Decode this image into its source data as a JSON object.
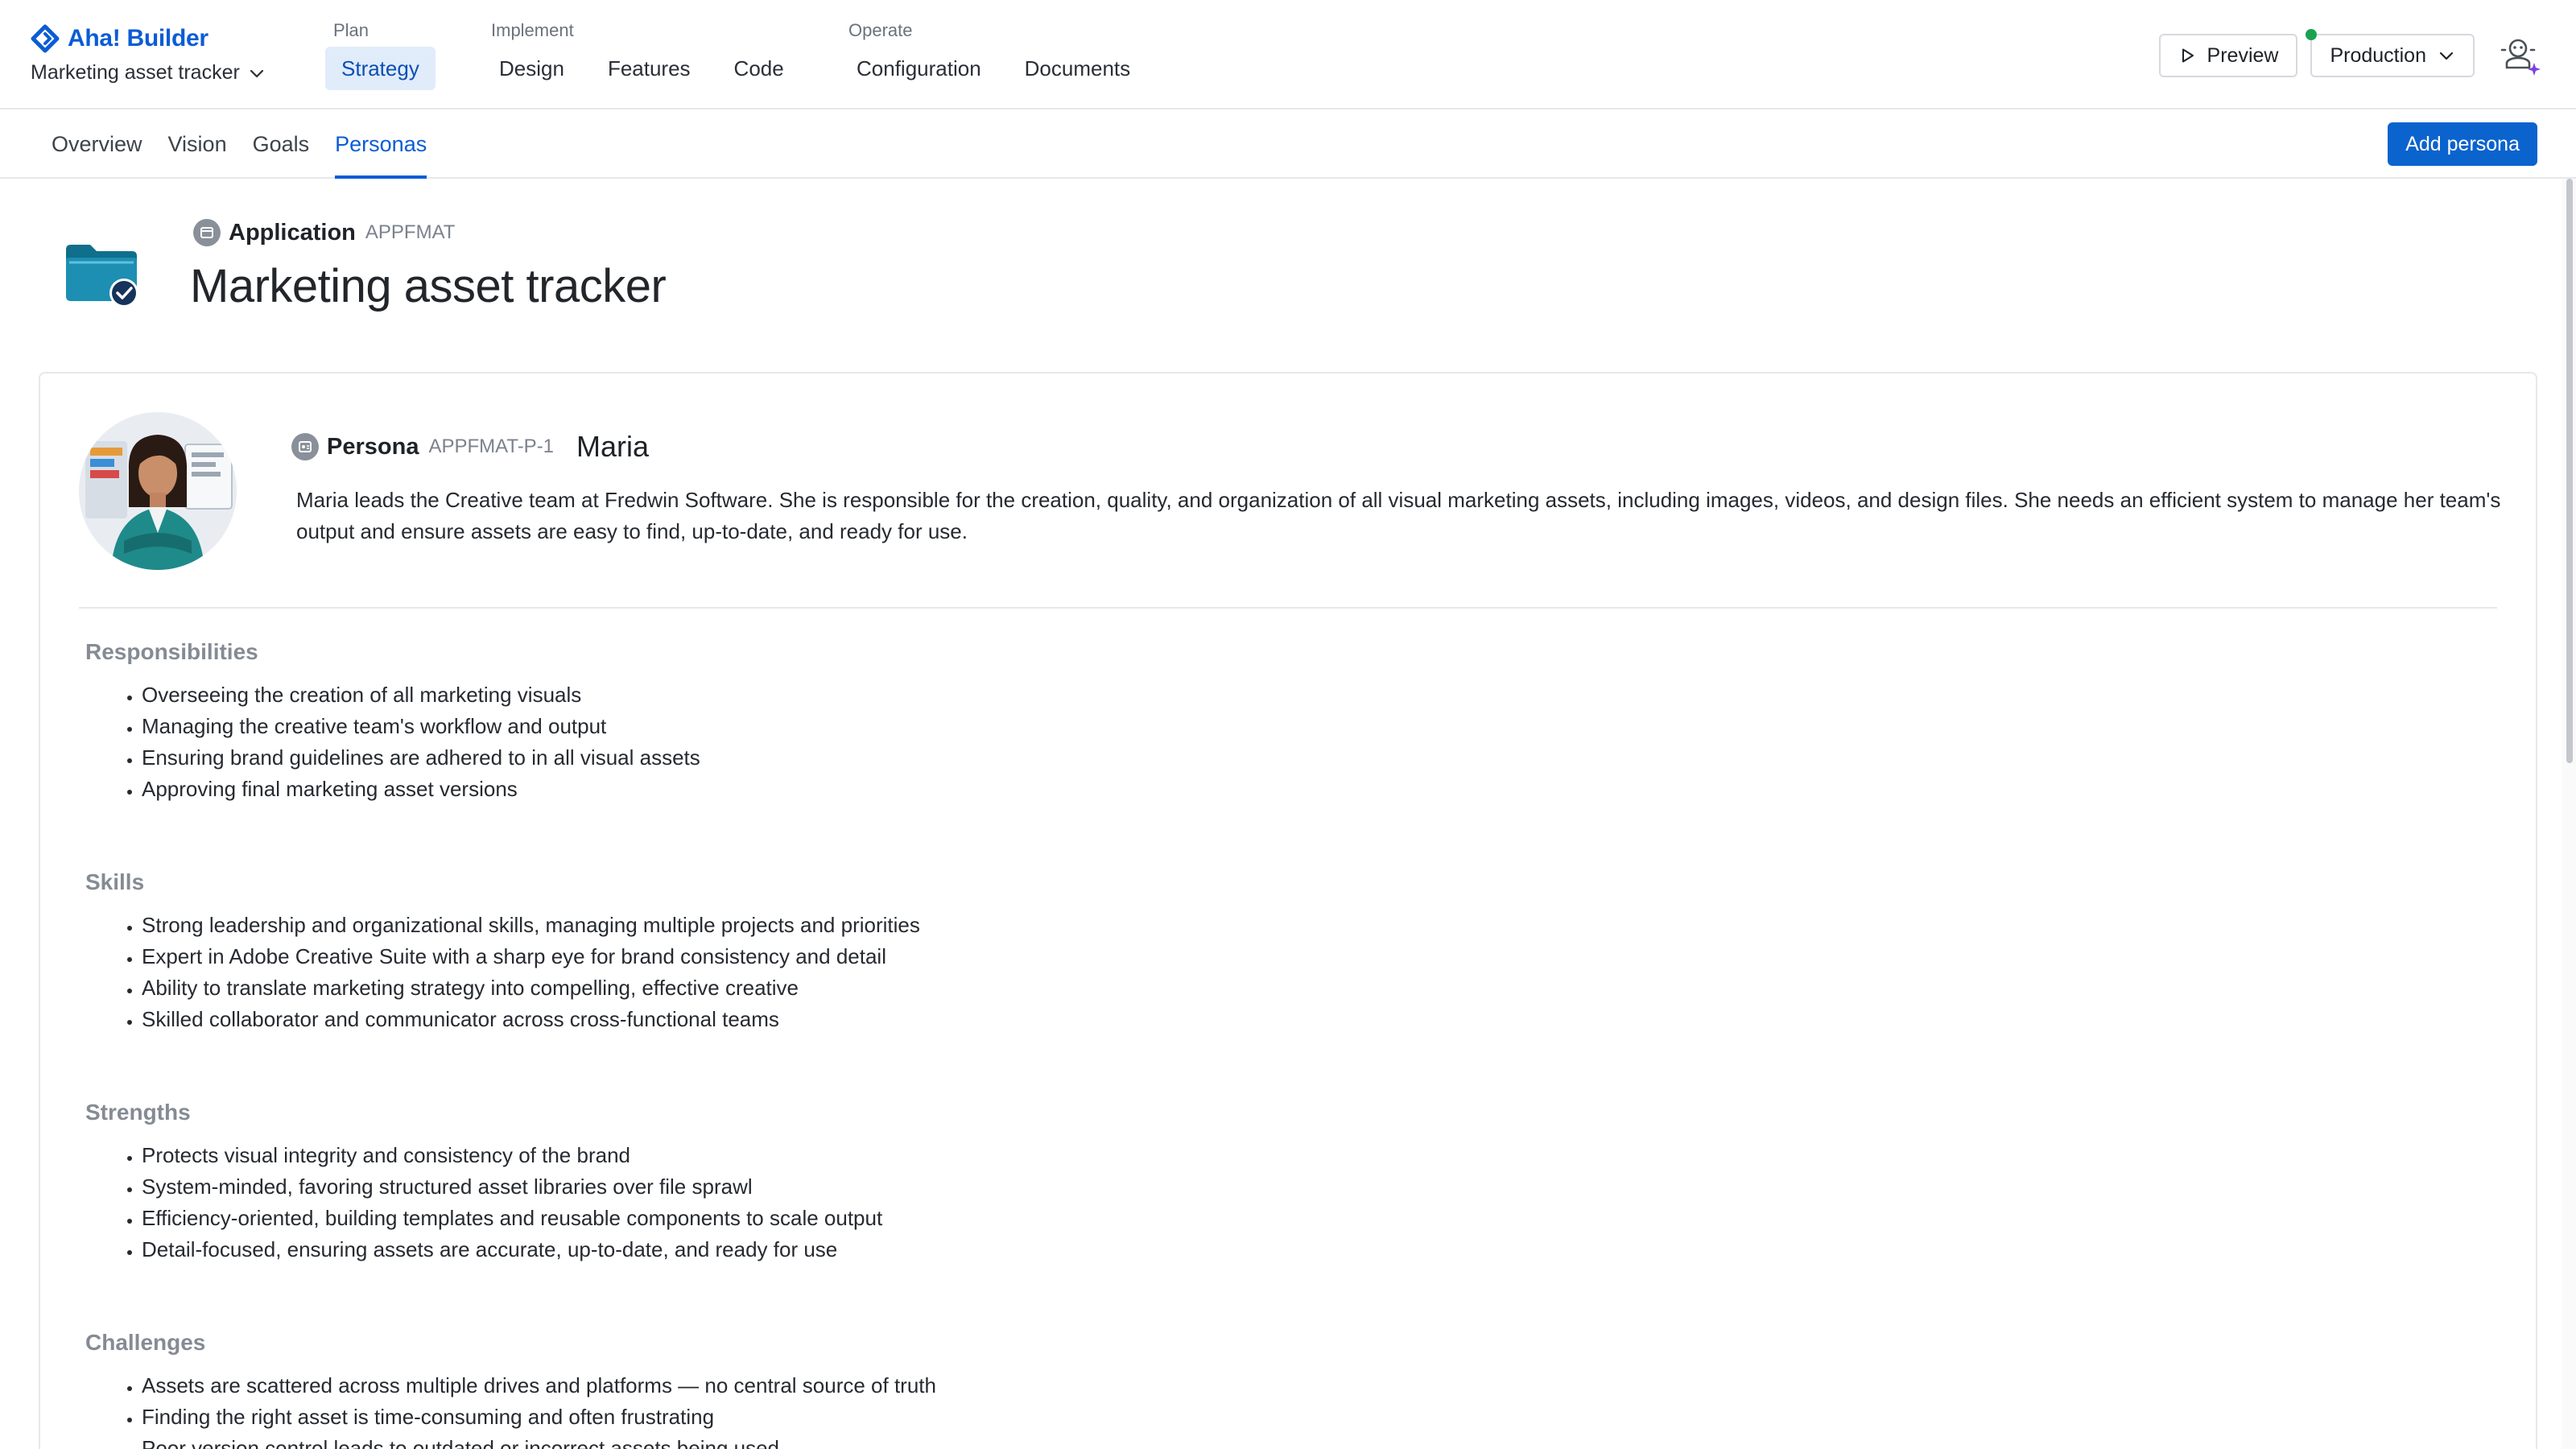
{
  "brand": {
    "name": "Aha! Builder",
    "logo_icon": "aha-diamond-logo-icon"
  },
  "app_switcher": {
    "label": "Marketing asset tracker"
  },
  "nav": {
    "groups": [
      {
        "label": "Plan",
        "items": [
          {
            "label": "Strategy",
            "active": true
          }
        ]
      },
      {
        "label": "Implement",
        "items": [
          {
            "label": "Design"
          },
          {
            "label": "Features"
          },
          {
            "label": "Code"
          }
        ]
      },
      {
        "label": "Operate",
        "items": [
          {
            "label": "Configuration"
          },
          {
            "label": "Documents"
          }
        ]
      }
    ]
  },
  "toolbar": {
    "preview_label": "Preview",
    "environment_label": "Production",
    "environment_status_color": "#1aa251"
  },
  "tabs": [
    {
      "label": "Overview"
    },
    {
      "label": "Vision"
    },
    {
      "label": "Goals"
    },
    {
      "label": "Personas",
      "active": true
    }
  ],
  "add_persona_label": "Add persona",
  "application": {
    "type_label": "Application",
    "key": "APPFMAT",
    "title": "Marketing asset tracker"
  },
  "persona": {
    "type_label": "Persona",
    "key": "APPFMAT-P-1",
    "name": "Maria",
    "description": "Maria leads the Creative team at Fredwin Software. She is responsible for the creation, quality, and organization of all visual marketing assets, including images, videos, and design files. She needs an efficient system to manage her team's output and ensure assets are easy to find, up-to-date, and ready for use.",
    "sections": [
      {
        "title": "Responsibilities",
        "items": [
          "Overseeing the creation of all marketing visuals",
          "Managing the creative team's workflow and output",
          "Ensuring brand guidelines are adhered to in all visual assets",
          "Approving final marketing asset versions"
        ]
      },
      {
        "title": "Skills",
        "items": [
          "Strong leadership and organizational skills, managing multiple projects and priorities",
          "Expert in Adobe Creative Suite with a sharp eye for brand consistency and detail",
          "Ability to translate marketing strategy into compelling, effective creative",
          "Skilled collaborator and communicator across cross-functional teams"
        ]
      },
      {
        "title": "Strengths",
        "items": [
          "Protects visual integrity and consistency of the brand",
          "System-minded, favoring structured asset libraries over file sprawl",
          "Efficiency-oriented, building templates and reusable components to scale output",
          "Detail-focused, ensuring assets are accurate, up-to-date, and ready for use"
        ]
      },
      {
        "title": "Challenges",
        "items": [
          "Assets are scattered across multiple drives and platforms — no central source of truth",
          "Finding the right asset is time-consuming and often frustrating",
          "Poor version control leads to outdated or incorrect assets being used"
        ]
      }
    ]
  },
  "colors": {
    "brand_blue": "#0b5cd5",
    "primary_button": "#0b63ce",
    "active_nav_bg": "#e1ecfb",
    "section_title": "#858b94"
  }
}
